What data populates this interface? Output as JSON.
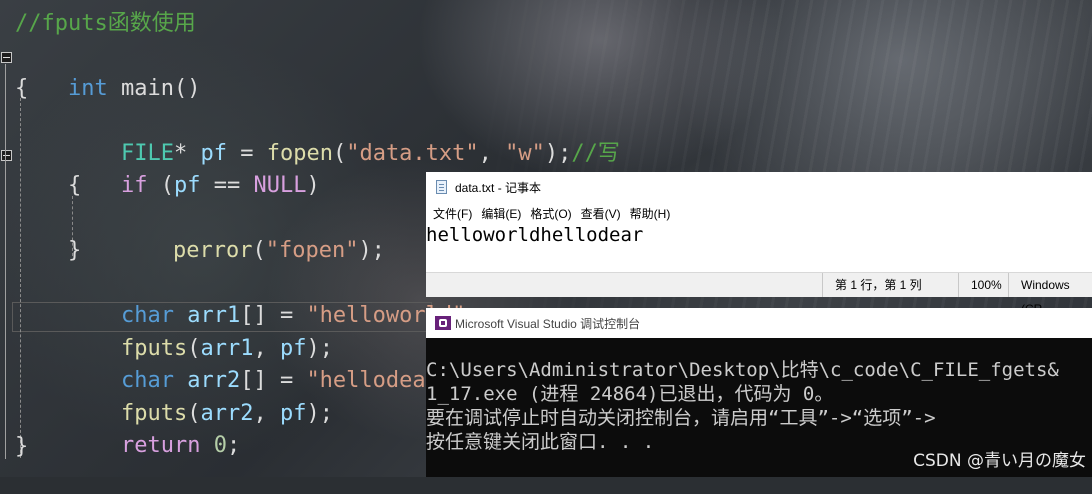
{
  "editor": {
    "comment": "//fputs函数使用",
    "lines": {
      "l1": {
        "kw": "int",
        "rest": " main()"
      },
      "l2": {
        "text": "{"
      },
      "l3": {
        "type": "FILE",
        "p1": "*",
        "id": " pf",
        "p2": " = ",
        "fn": "fopen",
        "p3": "(",
        "s1": "\"data.txt\"",
        "p4": ", ",
        "s2": "\"w\"",
        "p5": ");",
        "cm": "//写"
      },
      "l4": {
        "kw": "if",
        "p1": " (",
        "id": "pf",
        "p2": " == ",
        "nul": "NULL",
        "p3": ")"
      },
      "l5": {
        "text": "{"
      },
      "l6": {
        "fn": "perror",
        "p1": "(",
        "s": "\"fopen\"",
        "p2": ");"
      },
      "l7": {
        "text": "}"
      },
      "l8": {
        "kw": "char",
        "id": " arr1",
        "p1": "[] = ",
        "s": "\"helloworld\"",
        "p2": ";"
      },
      "l9": {
        "fn": "fputs",
        "p1": "(",
        "id1": "arr1",
        "p2": ", ",
        "id2": "pf",
        "p3": ");"
      },
      "l10": {
        "kw": "char",
        "id": " arr2",
        "p1": "[] = ",
        "s": "\"hellodear\"",
        "p2": ";"
      },
      "l11": {
        "fn": "fputs",
        "p1": "(",
        "id1": "arr2",
        "p2": ", ",
        "id2": "pf",
        "p3": ");"
      },
      "l12": {
        "kw": "return",
        "sp": " ",
        "num": "0",
        "p": ";"
      },
      "l13": {
        "text": "}"
      }
    }
  },
  "notepad": {
    "title": "data.txt - 记事本",
    "menu": [
      "文件(F)",
      "编辑(E)",
      "格式(O)",
      "查看(V)",
      "帮助(H)"
    ],
    "content": "helloworldhellodear",
    "status": {
      "position": "第 1 行，第 1 列",
      "zoom": "100%",
      "eol": "Windows (CR"
    }
  },
  "console": {
    "title": "Microsoft Visual Studio 调试控制台",
    "lines": [
      "C:\\Users\\Administrator\\Desktop\\比特\\c_code\\C_FILE_fgets&",
      "1_17.exe (进程 24864)已退出，代码为 0。",
      "要在调试停止时自动关闭控制台，请启用“工具”->“选项”->",
      "按任意键关闭此窗口. . ."
    ]
  },
  "watermark": "CSDN @青い月の魔女"
}
